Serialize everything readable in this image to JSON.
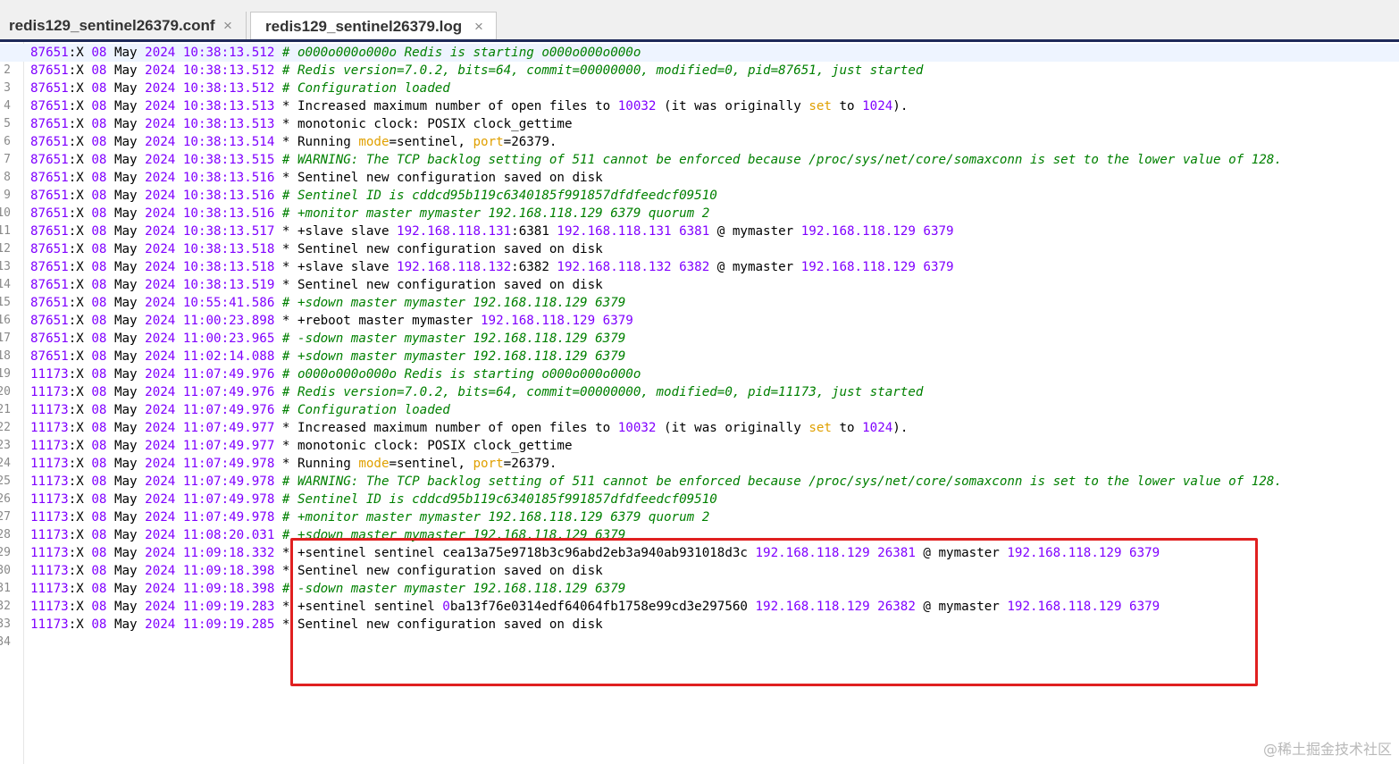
{
  "tabs": [
    {
      "label": "redis129_sentinel26379.conf",
      "close": "×"
    },
    {
      "label": "redis129_sentinel26379.log",
      "close": "×"
    }
  ],
  "colors": {
    "pid": "#8000ff",
    "comment": "#008000",
    "keyword": "#e0a000",
    "highlight_box": "#e02020"
  },
  "log_lines": [
    {
      "n": "1",
      "pid": "87651",
      "d": "08",
      "m": "May",
      "y": "2024",
      "t": "10:38:13.512",
      "mark": "#",
      "msg": [
        {
          "s": "o000o000o000o Redis is starting o000o000o000o",
          "c": "cmt"
        }
      ]
    },
    {
      "n": "2",
      "pid": "87651",
      "d": "08",
      "m": "May",
      "y": "2024",
      "t": "10:38:13.512",
      "mark": "#",
      "msg": [
        {
          "s": "Redis version=7.0.2, bits=64, commit=00000000, modified=0, pid=87651, just started",
          "c": "cmt"
        }
      ]
    },
    {
      "n": "3",
      "pid": "87651",
      "d": "08",
      "m": "May",
      "y": "2024",
      "t": "10:38:13.512",
      "mark": "#",
      "msg": [
        {
          "s": "Configuration loaded",
          "c": "cmt"
        }
      ]
    },
    {
      "n": "4",
      "pid": "87651",
      "d": "08",
      "m": "May",
      "y": "2024",
      "t": "10:38:13.513",
      "mark": "*",
      "msg": [
        {
          "s": "Increased maximum number of open files to ",
          "c": "txt"
        },
        {
          "s": "10032",
          "c": "num"
        },
        {
          "s": " (",
          "c": "txt"
        },
        {
          "s": "it was originally ",
          "c": "txt"
        },
        {
          "s": "set",
          "c": "kw"
        },
        {
          "s": " to ",
          "c": "txt"
        },
        {
          "s": "1024",
          "c": "num"
        },
        {
          "s": ").",
          "c": "txt"
        }
      ]
    },
    {
      "n": "5",
      "pid": "87651",
      "d": "08",
      "m": "May",
      "y": "2024",
      "t": "10:38:13.513",
      "mark": "*",
      "msg": [
        {
          "s": "monotonic clock: POSIX clock_gettime",
          "c": "txt"
        }
      ]
    },
    {
      "n": "6",
      "pid": "87651",
      "d": "08",
      "m": "May",
      "y": "2024",
      "t": "10:38:13.514",
      "mark": "*",
      "msg": [
        {
          "s": "Running ",
          "c": "txt"
        },
        {
          "s": "mode",
          "c": "kw"
        },
        {
          "s": "=sentinel, ",
          "c": "txt"
        },
        {
          "s": "port",
          "c": "kw"
        },
        {
          "s": "=26379.",
          "c": "txt"
        }
      ]
    },
    {
      "n": "7",
      "pid": "87651",
      "d": "08",
      "m": "May",
      "y": "2024",
      "t": "10:38:13.515",
      "mark": "#",
      "msg": [
        {
          "s": "WARNING: The TCP backlog setting of 511 cannot be enforced because /proc/sys/net/core/somaxconn is set to the lower value of 128.",
          "c": "cmt"
        }
      ]
    },
    {
      "n": "8",
      "pid": "87651",
      "d": "08",
      "m": "May",
      "y": "2024",
      "t": "10:38:13.516",
      "mark": "*",
      "msg": [
        {
          "s": "Sentinel new configuration saved on disk",
          "c": "txt"
        }
      ]
    },
    {
      "n": "9",
      "pid": "87651",
      "d": "08",
      "m": "May",
      "y": "2024",
      "t": "10:38:13.516",
      "mark": "#",
      "msg": [
        {
          "s": "Sentinel ID is cddcd95b119c6340185f991857dfdfeedcf09510",
          "c": "cmt"
        }
      ]
    },
    {
      "n": "10",
      "pid": "87651",
      "d": "08",
      "m": "May",
      "y": "2024",
      "t": "10:38:13.516",
      "mark": "#",
      "msg": [
        {
          "s": "+monitor master mymaster 192.168.118.129 6379 quorum 2",
          "c": "cmt"
        }
      ]
    },
    {
      "n": "11",
      "pid": "87651",
      "d": "08",
      "m": "May",
      "y": "2024",
      "t": "10:38:13.517",
      "mark": "*",
      "msg": [
        {
          "s": "+slave slave ",
          "c": "txt"
        },
        {
          "s": "192.168.118.131",
          "c": "num"
        },
        {
          "s": ":6381 ",
          "c": "txt"
        },
        {
          "s": "192.168.118.131 6381",
          "c": "num"
        },
        {
          "s": " @ mymaster ",
          "c": "txt"
        },
        {
          "s": "192.168.118.129 6379",
          "c": "num"
        }
      ]
    },
    {
      "n": "12",
      "pid": "87651",
      "d": "08",
      "m": "May",
      "y": "2024",
      "t": "10:38:13.518",
      "mark": "*",
      "msg": [
        {
          "s": "Sentinel new configuration saved on disk",
          "c": "txt"
        }
      ]
    },
    {
      "n": "13",
      "pid": "87651",
      "d": "08",
      "m": "May",
      "y": "2024",
      "t": "10:38:13.518",
      "mark": "*",
      "msg": [
        {
          "s": "+slave slave ",
          "c": "txt"
        },
        {
          "s": "192.168.118.132",
          "c": "num"
        },
        {
          "s": ":6382 ",
          "c": "txt"
        },
        {
          "s": "192.168.118.132 6382",
          "c": "num"
        },
        {
          "s": " @ mymaster ",
          "c": "txt"
        },
        {
          "s": "192.168.118.129 6379",
          "c": "num"
        }
      ]
    },
    {
      "n": "14",
      "pid": "87651",
      "d": "08",
      "m": "May",
      "y": "2024",
      "t": "10:38:13.519",
      "mark": "*",
      "msg": [
        {
          "s": "Sentinel new configuration saved on disk",
          "c": "txt"
        }
      ]
    },
    {
      "n": "15",
      "pid": "87651",
      "d": "08",
      "m": "May",
      "y": "2024",
      "t": "10:55:41.586",
      "mark": "#",
      "msg": [
        {
          "s": "+sdown master mymaster 192.168.118.129 6379",
          "c": "cmt"
        }
      ]
    },
    {
      "n": "16",
      "pid": "87651",
      "d": "08",
      "m": "May",
      "y": "2024",
      "t": "11:00:23.898",
      "mark": "*",
      "msg": [
        {
          "s": "+reboot master mymaster ",
          "c": "txt"
        },
        {
          "s": "192.168.118.129 6379",
          "c": "num"
        }
      ]
    },
    {
      "n": "17",
      "pid": "87651",
      "d": "08",
      "m": "May",
      "y": "2024",
      "t": "11:00:23.965",
      "mark": "#",
      "msg": [
        {
          "s": "-sdown master mymaster 192.168.118.129 6379",
          "c": "cmt"
        }
      ]
    },
    {
      "n": "18",
      "pid": "87651",
      "d": "08",
      "m": "May",
      "y": "2024",
      "t": "11:02:14.088",
      "mark": "#",
      "msg": [
        {
          "s": "+sdown master mymaster 192.168.118.129 6379",
          "c": "cmt"
        }
      ]
    },
    {
      "n": "19",
      "pid": "11173",
      "d": "08",
      "m": "May",
      "y": "2024",
      "t": "11:07:49.976",
      "mark": "#",
      "msg": [
        {
          "s": "o000o000o000o Redis is starting o000o000o000o",
          "c": "cmt"
        }
      ]
    },
    {
      "n": "20",
      "pid": "11173",
      "d": "08",
      "m": "May",
      "y": "2024",
      "t": "11:07:49.976",
      "mark": "#",
      "msg": [
        {
          "s": "Redis version=7.0.2, bits=64, commit=00000000, modified=0, pid=11173, just started",
          "c": "cmt"
        }
      ]
    },
    {
      "n": "21",
      "pid": "11173",
      "d": "08",
      "m": "May",
      "y": "2024",
      "t": "11:07:49.976",
      "mark": "#",
      "msg": [
        {
          "s": "Configuration loaded",
          "c": "cmt"
        }
      ]
    },
    {
      "n": "22",
      "pid": "11173",
      "d": "08",
      "m": "May",
      "y": "2024",
      "t": "11:07:49.977",
      "mark": "*",
      "msg": [
        {
          "s": "Increased maximum number of open files to ",
          "c": "txt"
        },
        {
          "s": "10032",
          "c": "num"
        },
        {
          "s": " (",
          "c": "txt"
        },
        {
          "s": "it was originally ",
          "c": "txt"
        },
        {
          "s": "set",
          "c": "kw"
        },
        {
          "s": " to ",
          "c": "txt"
        },
        {
          "s": "1024",
          "c": "num"
        },
        {
          "s": ").",
          "c": "txt"
        }
      ]
    },
    {
      "n": "23",
      "pid": "11173",
      "d": "08",
      "m": "May",
      "y": "2024",
      "t": "11:07:49.977",
      "mark": "*",
      "msg": [
        {
          "s": "monotonic clock: POSIX clock_gettime",
          "c": "txt"
        }
      ]
    },
    {
      "n": "24",
      "pid": "11173",
      "d": "08",
      "m": "May",
      "y": "2024",
      "t": "11:07:49.978",
      "mark": "*",
      "msg": [
        {
          "s": "Running ",
          "c": "txt"
        },
        {
          "s": "mode",
          "c": "kw"
        },
        {
          "s": "=sentinel, ",
          "c": "txt"
        },
        {
          "s": "port",
          "c": "kw"
        },
        {
          "s": "=26379.",
          "c": "txt"
        }
      ]
    },
    {
      "n": "25",
      "pid": "11173",
      "d": "08",
      "m": "May",
      "y": "2024",
      "t": "11:07:49.978",
      "mark": "#",
      "msg": [
        {
          "s": "WARNING: The TCP backlog setting of 511 cannot be enforced because /proc/sys/net/core/somaxconn is set to the lower value of 128.",
          "c": "cmt"
        }
      ]
    },
    {
      "n": "26",
      "pid": "11173",
      "d": "08",
      "m": "May",
      "y": "2024",
      "t": "11:07:49.978",
      "mark": "#",
      "msg": [
        {
          "s": "Sentinel ID is cddcd95b119c6340185f991857dfdfeedcf09510",
          "c": "cmt"
        }
      ]
    },
    {
      "n": "27",
      "pid": "11173",
      "d": "08",
      "m": "May",
      "y": "2024",
      "t": "11:07:49.978",
      "mark": "#",
      "msg": [
        {
          "s": "+monitor master mymaster 192.168.118.129 6379 quorum 2",
          "c": "cmt"
        }
      ]
    },
    {
      "n": "28",
      "pid": "11173",
      "d": "08",
      "m": "May",
      "y": "2024",
      "t": "11:08:20.031",
      "mark": "#",
      "msg": [
        {
          "s": "+sdown master mymaster 192.168.118.129 6379",
          "c": "cmt"
        }
      ]
    },
    {
      "n": "29",
      "pid": "11173",
      "d": "08",
      "m": "May",
      "y": "2024",
      "t": "11:09:18.332",
      "mark": "*",
      "msg": [
        {
          "s": "+sentinel sentinel cea13a75e9718b3c96abd2eb3a940ab931018d3c ",
          "c": "txt"
        },
        {
          "s": "192.168.118.129 26381",
          "c": "num"
        },
        {
          "s": " @ mymaster ",
          "c": "txt"
        },
        {
          "s": "192.168.118.129 6379",
          "c": "num"
        }
      ]
    },
    {
      "n": "30",
      "pid": "11173",
      "d": "08",
      "m": "May",
      "y": "2024",
      "t": "11:09:18.398",
      "mark": "*",
      "msg": [
        {
          "s": "Sentinel new configuration saved on disk",
          "c": "txt"
        }
      ]
    },
    {
      "n": "31",
      "pid": "11173",
      "d": "08",
      "m": "May",
      "y": "2024",
      "t": "11:09:18.398",
      "mark": "#",
      "msg": [
        {
          "s": "-sdown master mymaster 192.168.118.129 6379",
          "c": "cmt"
        }
      ]
    },
    {
      "n": "32",
      "pid": "11173",
      "d": "08",
      "m": "May",
      "y": "2024",
      "t": "11:09:19.283",
      "mark": "*",
      "msg": [
        {
          "s": "+sentinel sentinel ",
          "c": "txt"
        },
        {
          "s": "0",
          "c": "num"
        },
        {
          "s": "ba13f76e0314edf64064fb1758e99cd3e297560 ",
          "c": "txt"
        },
        {
          "s": "192.168.118.129 26382",
          "c": "num"
        },
        {
          "s": " @ mymaster ",
          "c": "txt"
        },
        {
          "s": "192.168.118.129 6379",
          "c": "num"
        }
      ]
    },
    {
      "n": "33",
      "pid": "11173",
      "d": "08",
      "m": "May",
      "y": "2024",
      "t": "11:09:19.285",
      "mark": "*",
      "msg": [
        {
          "s": "Sentinel new configuration saved on disk",
          "c": "txt"
        }
      ]
    }
  ],
  "last_line_number": "34",
  "watermark": "@稀土掘金技术社区"
}
